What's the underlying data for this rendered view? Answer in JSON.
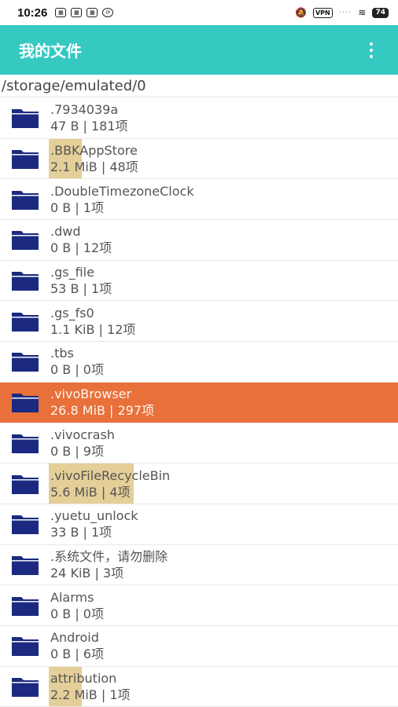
{
  "status": {
    "time": "10:26",
    "vpn": "VPN",
    "battery": "74"
  },
  "appbar": {
    "title": "我的文件"
  },
  "path": "/storage/emulated/0",
  "files": [
    {
      "name": ".7934039a",
      "meta": "47 B | 181项",
      "highlight": 0,
      "selected": false
    },
    {
      "name": ".BBKAppStore",
      "meta": "2.1 MiB | 48项",
      "highlight": 42,
      "selected": false
    },
    {
      "name": ".DoubleTimezoneClock",
      "meta": "0 B | 1项",
      "highlight": 0,
      "selected": false
    },
    {
      "name": ".dwd",
      "meta": "0 B | 12项",
      "highlight": 0,
      "selected": false
    },
    {
      "name": ".gs_file",
      "meta": "53 B | 1项",
      "highlight": 0,
      "selected": false
    },
    {
      "name": ".gs_fs0",
      "meta": "1.1 KiB | 12项",
      "highlight": 0,
      "selected": false
    },
    {
      "name": ".tbs",
      "meta": "0 B | 0项",
      "highlight": 0,
      "selected": false
    },
    {
      "name": ".vivoBrowser",
      "meta": "26.8 MiB | 297项",
      "highlight": 0,
      "selected": true
    },
    {
      "name": ".vivocrash",
      "meta": "0 B | 9项",
      "highlight": 0,
      "selected": false
    },
    {
      "name": ".vivoFileRecycleBin",
      "meta": "5.6 MiB | 4项",
      "highlight": 108,
      "selected": false
    },
    {
      "name": ".yuetu_unlock",
      "meta": "33 B | 1项",
      "highlight": 0,
      "selected": false
    },
    {
      "name": ".系统文件，请勿删除",
      "meta": "24 KiB | 3项",
      "highlight": 0,
      "selected": false
    },
    {
      "name": "Alarms",
      "meta": "0 B | 0项",
      "highlight": 0,
      "selected": false
    },
    {
      "name": "Android",
      "meta": "0 B | 6项",
      "highlight": 0,
      "selected": false
    },
    {
      "name": "attribution",
      "meta": "2.2 MiB | 1项",
      "highlight": 42,
      "selected": false
    }
  ],
  "colors": {
    "appbar": "#35c9c2",
    "selected_row": "#e8703a",
    "folder": "#1b2a80",
    "size_highlight": "#e5cf98"
  }
}
